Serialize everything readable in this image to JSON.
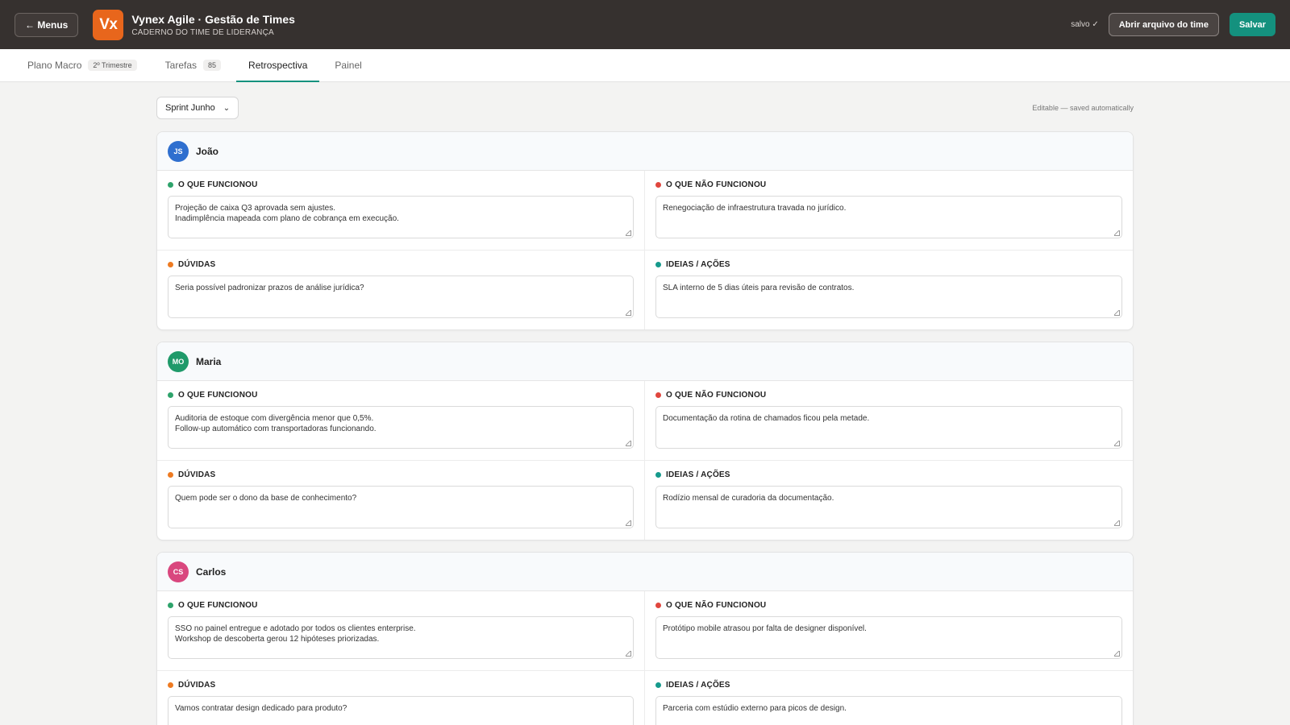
{
  "header": {
    "menus_label": "← Menus",
    "logo_text": "Vx",
    "title": "Vynex Agile · Gestão de Times",
    "subtitle": "CADERNO DO TIME DE LIDERANÇA",
    "saved_status": "salvo ✓",
    "open_file_label": "Abrir arquivo do time",
    "save_label": "Salvar",
    "accent_color": "#14917e",
    "logo_color": "#e8661c"
  },
  "tabs": [
    {
      "label": "Plano Macro",
      "badge": "2º Trimestre"
    },
    {
      "label": "Tarefas",
      "badge": "85"
    },
    {
      "label": "Retrospectiva",
      "badge": "",
      "active": true
    },
    {
      "label": "Painel",
      "badge": ""
    }
  ],
  "toolbar": {
    "sprint_value": "Sprint Junho",
    "editable_note": "Editable — saved automatically"
  },
  "labels": {
    "worked": "O QUE FUNCIONOU",
    "not_worked": "O QUE NÃO FUNCIONOU",
    "doubts": "DÚVIDAS",
    "ideas": "IDEIAS / AÇÕES"
  },
  "people": [
    {
      "initials": "JS",
      "name": "João",
      "avatar_color": "#2f6fcf",
      "worked": "Projeção de caixa Q3 aprovada sem ajustes.\nInadimplência mapeada com plano de cobrança em execução.",
      "not_worked": "Renegociação de infraestrutura travada no jurídico.",
      "doubts": "Seria possível padronizar prazos de análise jurídica?",
      "ideas": "SLA interno de 5 dias úteis para revisão de contratos."
    },
    {
      "initials": "MO",
      "name": "Maria",
      "avatar_color": "#1f9a6a",
      "worked": "Auditoria de estoque com divergência menor que 0,5%.\nFollow-up automático com transportadoras funcionando.",
      "not_worked": "Documentação da rotina de chamados ficou pela metade.",
      "doubts": "Quem pode ser o dono da base de conhecimento?",
      "ideas": "Rodízio mensal de curadoria da documentação."
    },
    {
      "initials": "CS",
      "name": "Carlos",
      "avatar_color": "#d9477e",
      "worked": "SSO no painel entregue e adotado por todos os clientes enterprise.\nWorkshop de descoberta gerou 12 hipóteses priorizadas.",
      "not_worked": "Protótipo mobile atrasou por falta de designer disponível.",
      "doubts": "Vamos contratar design dedicado para produto?",
      "ideas": "Parceria com estúdio externo para picos de design."
    }
  ]
}
